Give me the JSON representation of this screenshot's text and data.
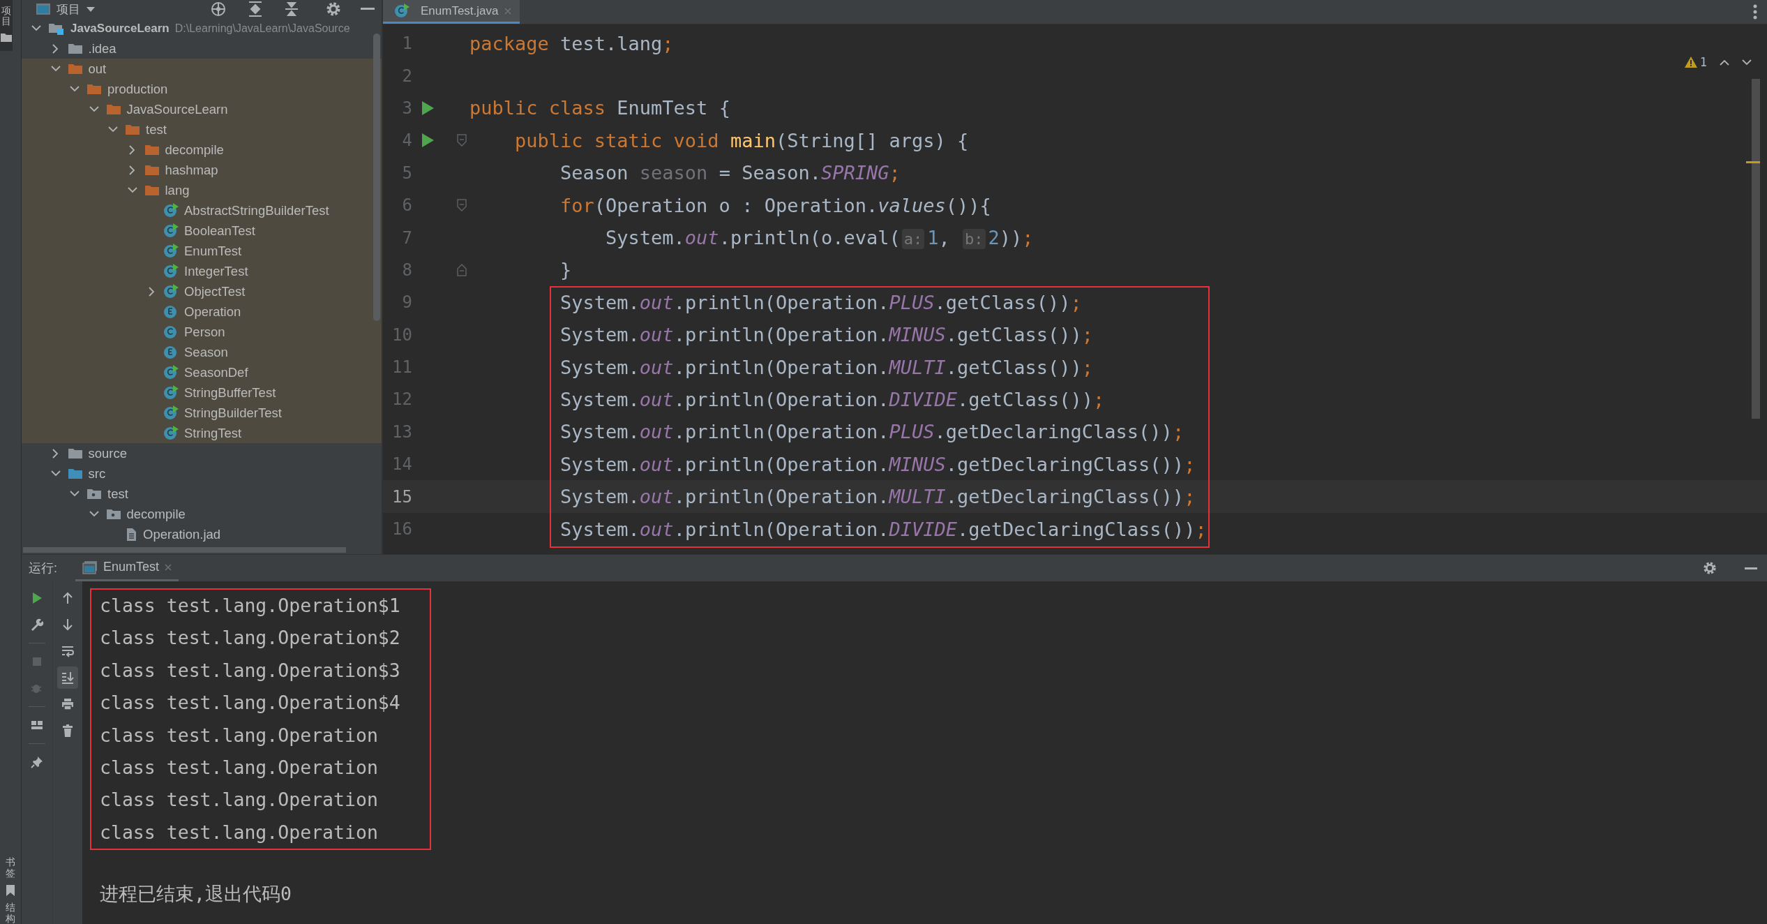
{
  "side_stripe": {
    "top": [
      {
        "label": "项目",
        "selected": true
      }
    ],
    "bottom": [
      {
        "label": "书签"
      },
      {
        "label": "结构"
      }
    ]
  },
  "project": {
    "title": "项目",
    "tree": [
      {
        "label": "JavaSourceLearn",
        "path": "D:\\Learning\\JavaLearn\\JavaSource",
        "kind": "project",
        "expanded": true,
        "children": [
          {
            "label": ".idea",
            "kind": "folder",
            "expanded": false
          },
          {
            "label": "out",
            "kind": "excluded-folder",
            "expanded": true,
            "children": [
              {
                "label": "production",
                "kind": "excluded-folder",
                "expanded": true,
                "children": [
                  {
                    "label": "JavaSourceLearn",
                    "kind": "excluded-folder",
                    "expanded": true,
                    "children": [
                      {
                        "label": "test",
                        "kind": "excluded-folder",
                        "expanded": true,
                        "children": [
                          {
                            "label": "decompile",
                            "kind": "excluded-folder",
                            "expanded": false
                          },
                          {
                            "label": "hashmap",
                            "kind": "excluded-folder",
                            "expanded": false
                          },
                          {
                            "label": "lang",
                            "kind": "excluded-folder",
                            "expanded": true,
                            "children": [
                              {
                                "label": "AbstractStringBuilderTest",
                                "kind": "class",
                                "runnable": true
                              },
                              {
                                "label": "BooleanTest",
                                "kind": "class",
                                "runnable": true
                              },
                              {
                                "label": "EnumTest",
                                "kind": "class",
                                "runnable": true
                              },
                              {
                                "label": "IntegerTest",
                                "kind": "class",
                                "runnable": true
                              },
                              {
                                "label": "ObjectTest",
                                "kind": "class",
                                "runnable": true,
                                "expanded": false
                              },
                              {
                                "label": "Operation",
                                "kind": "enum",
                                "runnable": false
                              },
                              {
                                "label": "Person",
                                "kind": "class",
                                "runnable": false
                              },
                              {
                                "label": "Season",
                                "kind": "enum",
                                "runnable": false
                              },
                              {
                                "label": "SeasonDef",
                                "kind": "class",
                                "runnable": true
                              },
                              {
                                "label": "StringBufferTest",
                                "kind": "class",
                                "runnable": true
                              },
                              {
                                "label": "StringBuilderTest",
                                "kind": "class",
                                "runnable": true
                              },
                              {
                                "label": "StringTest",
                                "kind": "class",
                                "runnable": true
                              }
                            ]
                          }
                        ]
                      }
                    ]
                  }
                ]
              }
            ]
          },
          {
            "label": "source",
            "kind": "folder",
            "expanded": false
          },
          {
            "label": "src",
            "kind": "source-folder",
            "expanded": true,
            "children": [
              {
                "label": "test",
                "kind": "package",
                "expanded": true,
                "children": [
                  {
                    "label": "decompile",
                    "kind": "package",
                    "expanded": true,
                    "children": [
                      {
                        "label": "Operation.jad",
                        "kind": "file"
                      }
                    ]
                  }
                ]
              }
            ]
          }
        ]
      }
    ]
  },
  "editor": {
    "tabs": [
      {
        "label": "EnumTest.java",
        "selected": true
      }
    ],
    "warnings": "1",
    "lines": [
      {
        "number": "1",
        "run_marker": false,
        "fold_open": false,
        "fold_close": false,
        "current": false,
        "boxed": false,
        "tokens": [
          {
            "kind": "keyword",
            "text": "package"
          },
          {
            "kind": "plain",
            "text": " test.lang"
          },
          {
            "kind": "keyword",
            "text": ";"
          }
        ]
      },
      {
        "number": "2",
        "run_marker": false,
        "fold_open": false,
        "fold_close": false,
        "current": false,
        "boxed": false
      },
      {
        "number": "3",
        "run_marker": true,
        "fold_open": false,
        "fold_close": false,
        "current": false,
        "boxed": false,
        "tokens": [
          {
            "kind": "keyword",
            "text": "public class"
          },
          {
            "kind": "plain",
            "text": " EnumTest {"
          }
        ]
      },
      {
        "number": "4",
        "run_marker": true,
        "fold_open": true,
        "fold_close": false,
        "current": false,
        "boxed": false,
        "tokens": [
          {
            "kind": "keyword",
            "text": "    public static void "
          },
          {
            "kind": "declaration",
            "text": "main"
          },
          {
            "kind": "plain",
            "text": "(String[] args) {"
          }
        ]
      },
      {
        "number": "5",
        "run_marker": false,
        "fold_open": false,
        "fold_close": false,
        "current": false,
        "boxed": false,
        "tokens": [
          {
            "kind": "plain",
            "text": "        Season "
          },
          {
            "kind": "unused",
            "text": "season"
          },
          {
            "kind": "plain",
            "text": " = Season."
          },
          {
            "kind": "field",
            "text": "SPRING"
          },
          {
            "kind": "keyword",
            "text": ";"
          }
        ]
      },
      {
        "number": "6",
        "run_marker": false,
        "fold_open": true,
        "fold_close": false,
        "current": false,
        "boxed": false,
        "tokens": [
          {
            "kind": "keyword",
            "text": "        for"
          },
          {
            "kind": "plain",
            "text": "(Operation o : Operation."
          },
          {
            "kind": "static-call",
            "text": "values"
          },
          {
            "kind": "plain",
            "text": "()){"
          }
        ]
      },
      {
        "number": "7",
        "run_marker": false,
        "fold_open": false,
        "fold_close": false,
        "current": false,
        "boxed": false,
        "tokens": [
          {
            "kind": "plain",
            "text": "            System."
          },
          {
            "kind": "field",
            "text": "out"
          },
          {
            "kind": "plain",
            "text": ".println(o.eval("
          },
          {
            "kind": "hint",
            "text": "a:"
          },
          {
            "kind": "number",
            "text": "1"
          },
          {
            "kind": "plain",
            "text": ", "
          },
          {
            "kind": "hint",
            "text": "b:"
          },
          {
            "kind": "number",
            "text": "2"
          },
          {
            "kind": "plain",
            "text": "))"
          },
          {
            "kind": "keyword",
            "text": ";"
          }
        ]
      },
      {
        "number": "8",
        "run_marker": false,
        "fold_open": false,
        "fold_close": true,
        "current": false,
        "boxed": false,
        "tokens": [
          {
            "kind": "plain",
            "text": "        }"
          }
        ]
      },
      {
        "number": "9",
        "run_marker": false,
        "fold_open": false,
        "fold_close": false,
        "current": false,
        "boxed": true,
        "tokens": [
          {
            "kind": "plain",
            "text": "        System."
          },
          {
            "kind": "field",
            "text": "out"
          },
          {
            "kind": "plain",
            "text": ".println(Operation."
          },
          {
            "kind": "field",
            "text": "PLUS"
          },
          {
            "kind": "plain",
            "text": ".getClass())"
          },
          {
            "kind": "keyword",
            "text": ";"
          }
        ]
      },
      {
        "number": "10",
        "run_marker": false,
        "fold_open": false,
        "fold_close": false,
        "current": false,
        "boxed": true,
        "tokens": [
          {
            "kind": "plain",
            "text": "        System."
          },
          {
            "kind": "field",
            "text": "out"
          },
          {
            "kind": "plain",
            "text": ".println(Operation."
          },
          {
            "kind": "field",
            "text": "MINUS"
          },
          {
            "kind": "plain",
            "text": ".getClass())"
          },
          {
            "kind": "keyword",
            "text": ";"
          }
        ]
      },
      {
        "number": "11",
        "run_marker": false,
        "fold_open": false,
        "fold_close": false,
        "current": false,
        "boxed": true,
        "tokens": [
          {
            "kind": "plain",
            "text": "        System."
          },
          {
            "kind": "field",
            "text": "out"
          },
          {
            "kind": "plain",
            "text": ".println(Operation."
          },
          {
            "kind": "field",
            "text": "MULTI"
          },
          {
            "kind": "plain",
            "text": ".getClass())"
          },
          {
            "kind": "keyword",
            "text": ";"
          }
        ]
      },
      {
        "number": "12",
        "run_marker": false,
        "fold_open": false,
        "fold_close": false,
        "current": false,
        "boxed": true,
        "tokens": [
          {
            "kind": "plain",
            "text": "        System."
          },
          {
            "kind": "field",
            "text": "out"
          },
          {
            "kind": "plain",
            "text": ".println(Operation."
          },
          {
            "kind": "field",
            "text": "DIVIDE"
          },
          {
            "kind": "plain",
            "text": ".getClass())"
          },
          {
            "kind": "keyword",
            "text": ";"
          }
        ]
      },
      {
        "number": "13",
        "run_marker": false,
        "fold_open": false,
        "fold_close": false,
        "current": false,
        "boxed": true,
        "tokens": [
          {
            "kind": "plain",
            "text": "        System."
          },
          {
            "kind": "field",
            "text": "out"
          },
          {
            "kind": "plain",
            "text": ".println(Operation."
          },
          {
            "kind": "field",
            "text": "PLUS"
          },
          {
            "kind": "plain",
            "text": ".getDeclaringClass())"
          },
          {
            "kind": "keyword",
            "text": ";"
          }
        ]
      },
      {
        "number": "14",
        "run_marker": false,
        "fold_open": false,
        "fold_close": false,
        "current": false,
        "boxed": true,
        "tokens": [
          {
            "kind": "plain",
            "text": "        System."
          },
          {
            "kind": "field",
            "text": "out"
          },
          {
            "kind": "plain",
            "text": ".println(Operation."
          },
          {
            "kind": "field",
            "text": "MINUS"
          },
          {
            "kind": "plain",
            "text": ".getDeclaringClass())"
          },
          {
            "kind": "keyword",
            "text": ";"
          }
        ]
      },
      {
        "number": "15",
        "run_marker": false,
        "fold_open": false,
        "fold_close": false,
        "current": true,
        "boxed": true,
        "tokens": [
          {
            "kind": "plain",
            "text": "        System."
          },
          {
            "kind": "field",
            "text": "out"
          },
          {
            "kind": "plain",
            "text": ".println(Operation."
          },
          {
            "kind": "field",
            "text": "MULTI"
          },
          {
            "kind": "plain",
            "text": ".getDeclaringClass())"
          },
          {
            "kind": "keyword",
            "text": ";"
          }
        ]
      },
      {
        "number": "16",
        "run_marker": false,
        "fold_open": false,
        "fold_close": false,
        "current": false,
        "boxed": true,
        "tokens": [
          {
            "kind": "plain",
            "text": "        System."
          },
          {
            "kind": "field",
            "text": "out"
          },
          {
            "kind": "plain",
            "text": ".println(Operation."
          },
          {
            "kind": "field",
            "text": "DIVIDE"
          },
          {
            "kind": "plain",
            "text": ".getDeclaringClass())"
          },
          {
            "kind": "keyword",
            "text": ";"
          }
        ]
      }
    ]
  },
  "run": {
    "label": "运行:",
    "tabs": [
      {
        "label": "EnumTest",
        "selected": true
      }
    ],
    "toolbar_left": [
      [
        {
          "kind": "rerun",
          "disabled": false
        },
        {
          "kind": "wrench",
          "disabled": false
        }
      ],
      [
        {
          "kind": "stop",
          "disabled": true
        },
        {
          "kind": "debug",
          "disabled": true
        }
      ],
      [
        {
          "kind": "layout",
          "disabled": false
        }
      ],
      [
        {
          "kind": "pin",
          "disabled": false
        }
      ]
    ],
    "toolbar_right": [
      {
        "kind": "up",
        "selected": false
      },
      {
        "kind": "down",
        "selected": false
      },
      {
        "kind": "wrap",
        "selected": false
      },
      {
        "kind": "scroll-end",
        "selected": true
      },
      {
        "kind": "print",
        "selected": false
      },
      {
        "kind": "trash",
        "selected": false
      }
    ],
    "output": [
      {
        "text": "class test.lang.Operation$1",
        "boxed": true
      },
      {
        "text": "class test.lang.Operation$2",
        "boxed": true
      },
      {
        "text": "class test.lang.Operation$3",
        "boxed": true
      },
      {
        "text": "class test.lang.Operation$4",
        "boxed": true
      },
      {
        "text": "class test.lang.Operation",
        "boxed": true
      },
      {
        "text": "class test.lang.Operation",
        "boxed": true
      },
      {
        "text": "class test.lang.Operation",
        "boxed": true
      },
      {
        "text": "class test.lang.Operation",
        "boxed": true
      }
    ],
    "exit_message": "进程已结束,退出代码0"
  }
}
